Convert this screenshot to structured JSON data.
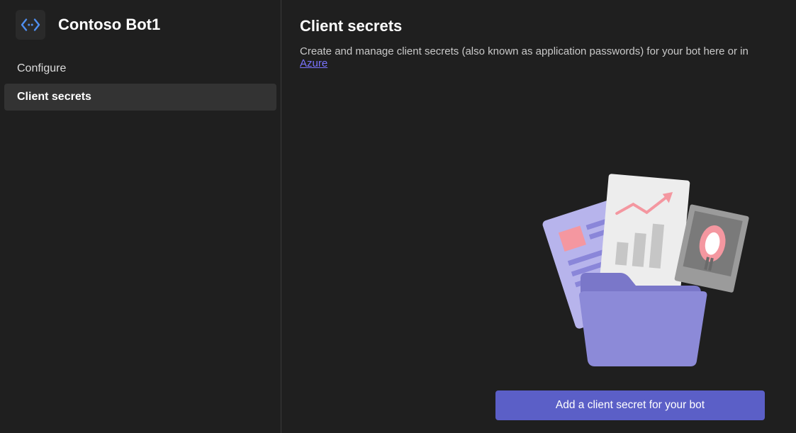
{
  "header": {
    "appTitle": "Contoso Bot1"
  },
  "sidebar": {
    "items": [
      {
        "label": "Configure",
        "active": false
      },
      {
        "label": "Client secrets",
        "active": true
      }
    ]
  },
  "main": {
    "pageTitle": "Client secrets",
    "descPrefix": "Create and manage client secrets (also known as application passwords) for your bot here or in ",
    "descLinkText": "Azure",
    "addBtnLabel": "Add a client secret for your bot"
  },
  "icons": {
    "botIcon": "bot-icon"
  }
}
